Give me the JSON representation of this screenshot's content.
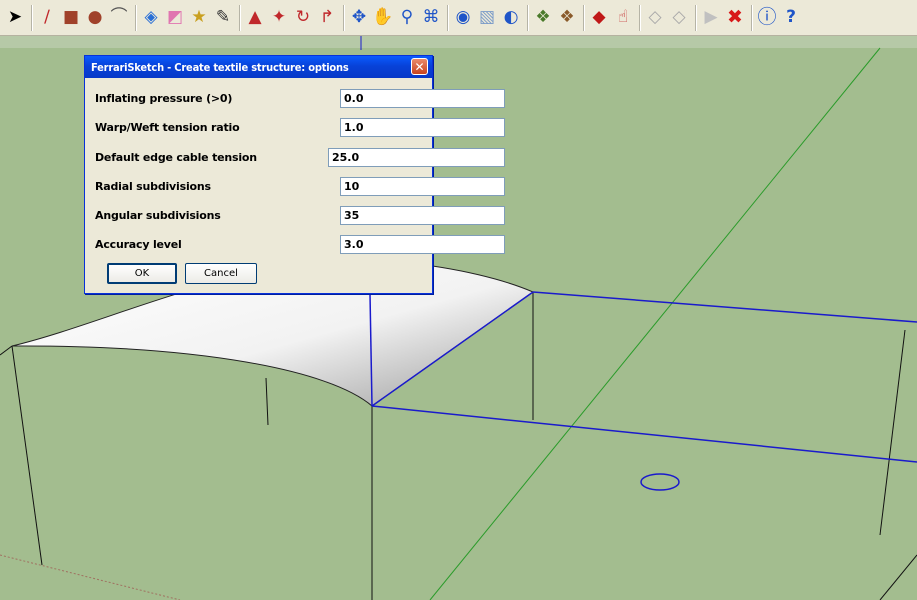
{
  "toolbar": {
    "icons": [
      "select-arrow-icon",
      "pencil-icon",
      "rectangle-icon",
      "circle-icon",
      "arc-icon",
      "eraser-icon",
      "paint-bucket-icon",
      "tape-measure-icon",
      "paint-brush-icon",
      "push-pull-icon",
      "move-icon",
      "rotate-icon",
      "offset-icon",
      "orbit-icon",
      "pan-icon",
      "zoom-icon",
      "zoom-extents-icon",
      "globe-icon",
      "model-icon",
      "earth-icon",
      "component-icon",
      "material-icon",
      "ferrari-tent-icon",
      "hand-icon",
      "cable-icon",
      "edge-icon",
      "play-icon",
      "red-x-icon",
      "info-icon",
      "help-icon"
    ]
  },
  "dialog": {
    "title": "FerrariSketch - Create textile structure: options",
    "close_label": "✕",
    "rows": [
      {
        "label": "Inflating pressure (>0)",
        "value": "0.0"
      },
      {
        "label": "Warp/Weft tension ratio",
        "value": "1.0"
      },
      {
        "label": "Default edge cable tension",
        "value": "25.0"
      },
      {
        "label": "Radial subdivisions",
        "value": "10"
      },
      {
        "label": "Angular subdivisions",
        "value": "35"
      },
      {
        "label": "Accuracy level",
        "value": "3.0"
      }
    ],
    "ok_label": "OK",
    "cancel_label": "Cancel"
  },
  "colors": {
    "background": "#a3bd8f",
    "selected_edge": "#1a1acc",
    "axis_green": "#2a9b2a"
  }
}
